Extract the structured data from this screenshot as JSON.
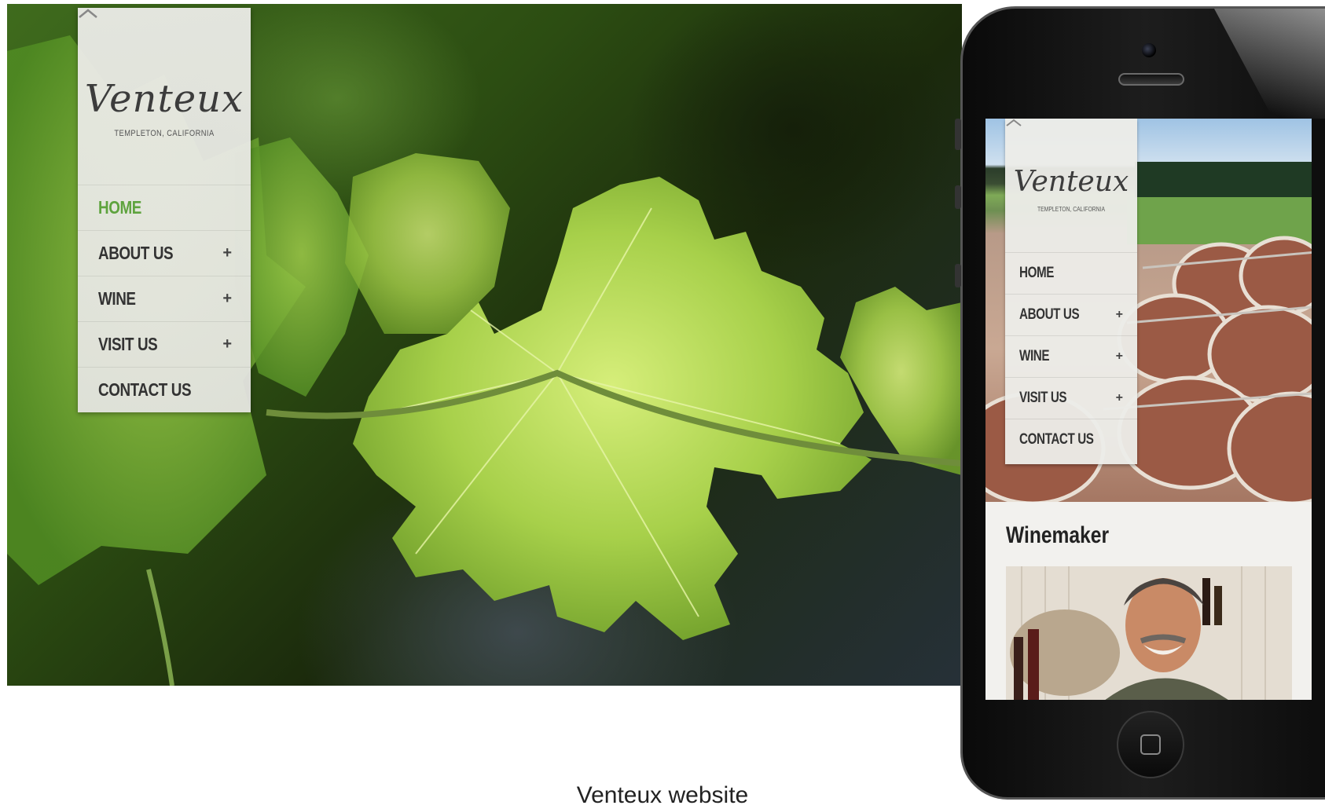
{
  "brand": {
    "logo_text": "Venteux",
    "location": "TEMPLETON, CALIFORNIA"
  },
  "desktop_menu": {
    "items": [
      {
        "label": "HOME",
        "has_submenu": false,
        "active": true
      },
      {
        "label": "ABOUT US",
        "has_submenu": true,
        "active": false
      },
      {
        "label": "WINE",
        "has_submenu": true,
        "active": false
      },
      {
        "label": "VISIT US",
        "has_submenu": true,
        "active": false
      },
      {
        "label": "CONTACT US",
        "has_submenu": false,
        "active": false
      }
    ],
    "plus_glyph": "+"
  },
  "mobile_menu": {
    "items": [
      {
        "label": "HOME",
        "has_submenu": false
      },
      {
        "label": "ABOUT US",
        "has_submenu": true
      },
      {
        "label": "WINE",
        "has_submenu": true
      },
      {
        "label": "VISIT US",
        "has_submenu": true
      },
      {
        "label": "CONTACT US",
        "has_submenu": false
      }
    ],
    "plus_glyph": "+"
  },
  "mobile_content": {
    "section_title": "Winemaker"
  },
  "caption": "Venteux website",
  "colors": {
    "active_menu": "#5ea33e",
    "menu_text": "#333333",
    "menu_bg": "#ececE8"
  },
  "icons": {
    "collapse": "chevron-up-icon",
    "expand": "plus-icon",
    "home_button": "home-button-icon"
  }
}
